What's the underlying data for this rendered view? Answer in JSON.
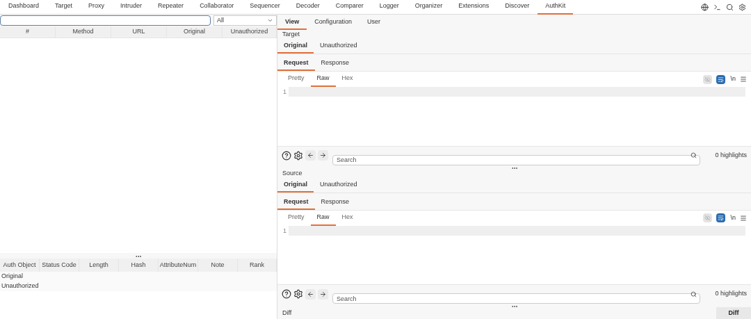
{
  "top_tabs": [
    {
      "label": "Dashboard",
      "selected": false
    },
    {
      "label": "Target",
      "selected": false
    },
    {
      "label": "Proxy",
      "selected": false
    },
    {
      "label": "Intruder",
      "selected": false
    },
    {
      "label": "Repeater",
      "selected": false
    },
    {
      "label": "Collaborator",
      "selected": false
    },
    {
      "label": "Sequencer",
      "selected": false
    },
    {
      "label": "Decoder",
      "selected": false
    },
    {
      "label": "Comparer",
      "selected": false
    },
    {
      "label": "Logger",
      "selected": false
    },
    {
      "label": "Organizer",
      "selected": false
    },
    {
      "label": "Extensions",
      "selected": false
    },
    {
      "label": "Discover",
      "selected": false
    },
    {
      "label": "AuthKit",
      "selected": true
    }
  ],
  "left": {
    "filter_select": {
      "value": "All"
    },
    "requests_table": {
      "columns": [
        "#",
        "Method",
        "URL",
        "Original",
        "Unauthorized"
      ]
    },
    "results_table": {
      "columns": [
        "Auth Object",
        "Status Code",
        "Length",
        "Hash",
        "AttributeNum",
        "Note",
        "Rank"
      ],
      "rows": [
        {
          "auth_object": "Original"
        },
        {
          "auth_object": "Unauthorized"
        }
      ]
    }
  },
  "right": {
    "tabs": [
      {
        "label": "View",
        "selected": true
      },
      {
        "label": "Configuration",
        "selected": false
      },
      {
        "label": "User",
        "selected": false
      }
    ],
    "sections": [
      {
        "title": "Target",
        "auth_tabs": [
          {
            "label": "Original",
            "selected": true
          },
          {
            "label": "Unauthorized",
            "selected": false
          }
        ],
        "message_tabs": [
          {
            "label": "Request",
            "selected": true
          },
          {
            "label": "Response",
            "selected": false
          }
        ],
        "view_tabs": [
          {
            "label": "Pretty",
            "selected": false
          },
          {
            "label": "Raw",
            "selected": true
          },
          {
            "label": "Hex",
            "selected": false
          }
        ],
        "newline_toggle": "\\n",
        "line_numbers": [
          "1"
        ],
        "search": {
          "placeholder": "Search"
        },
        "highlights": "0 highlights"
      },
      {
        "title": "Source",
        "auth_tabs": [
          {
            "label": "Original",
            "selected": true
          },
          {
            "label": "Unauthorized",
            "selected": false
          }
        ],
        "message_tabs": [
          {
            "label": "Request",
            "selected": true
          },
          {
            "label": "Response",
            "selected": false
          }
        ],
        "view_tabs": [
          {
            "label": "Pretty",
            "selected": false
          },
          {
            "label": "Raw",
            "selected": true
          },
          {
            "label": "Hex",
            "selected": false
          }
        ],
        "newline_toggle": "\\n",
        "line_numbers": [
          "1"
        ],
        "search": {
          "placeholder": "Search"
        },
        "highlights": "0 highlights"
      }
    ],
    "diff": {
      "label": "Diff",
      "button": "Diff"
    }
  }
}
